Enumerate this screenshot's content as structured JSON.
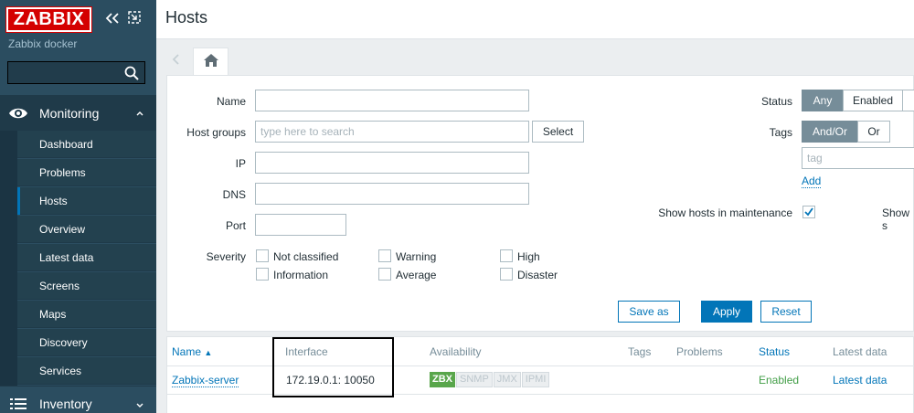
{
  "sidebar": {
    "logo": "ZABBIX",
    "server_name": "Zabbix docker",
    "search_value": "",
    "monitoring_label": "Monitoring",
    "inventory_label": "Inventory",
    "items": [
      {
        "label": "Dashboard"
      },
      {
        "label": "Problems"
      },
      {
        "label": "Hosts",
        "active": true
      },
      {
        "label": "Overview"
      },
      {
        "label": "Latest data"
      },
      {
        "label": "Screens"
      },
      {
        "label": "Maps"
      },
      {
        "label": "Discovery"
      },
      {
        "label": "Services"
      }
    ]
  },
  "header": {
    "title": "Hosts"
  },
  "filter": {
    "name_label": "Name",
    "name_value": "",
    "host_groups_label": "Host groups",
    "host_groups_placeholder": "type here to search",
    "select_label": "Select",
    "ip_label": "IP",
    "ip_value": "",
    "dns_label": "DNS",
    "dns_value": "",
    "port_label": "Port",
    "port_value": "",
    "severity_label": "Severity",
    "severities": [
      {
        "label": "Not classified",
        "checked": false
      },
      {
        "label": "Warning",
        "checked": false
      },
      {
        "label": "High",
        "checked": false
      },
      {
        "label": "Information",
        "checked": false
      },
      {
        "label": "Average",
        "checked": false
      },
      {
        "label": "Disaster",
        "checked": false
      }
    ],
    "status_label": "Status",
    "status_options": [
      "Any",
      "Enabled"
    ],
    "status_selected": "Any",
    "tags_label": "Tags",
    "tags_options": [
      "And/Or",
      "Or"
    ],
    "tags_selected": "And/Or",
    "tag_placeholder": "tag",
    "add_label": "Add",
    "show_maintenance_label": "Show hosts in maintenance",
    "show_maintenance_checked": true,
    "show_suppressed_label": "Show s",
    "save_as_label": "Save as",
    "apply_label": "Apply",
    "reset_label": "Reset"
  },
  "table": {
    "columns": [
      "Name",
      "Interface",
      "Availability",
      "Tags",
      "Problems",
      "Status",
      "Latest data"
    ],
    "sort_indicator": "▲",
    "rows": [
      {
        "name": "Zabbix-server",
        "interface": "172.19.0.1: 10050",
        "availability": [
          {
            "label": "ZBX",
            "active": true
          },
          {
            "label": "SNMP",
            "active": false
          },
          {
            "label": "JMX",
            "active": false
          },
          {
            "label": "IPMI",
            "active": false
          }
        ],
        "tags": "",
        "problems": "",
        "status": "Enabled",
        "latest_data": "Latest data"
      }
    ]
  },
  "colors": {
    "sidebar_bg": "#2b4d60",
    "accent": "#0275b8",
    "logo_red": "#d40000",
    "enabled_green": "#429e47",
    "zbx_green": "#59a64b"
  }
}
